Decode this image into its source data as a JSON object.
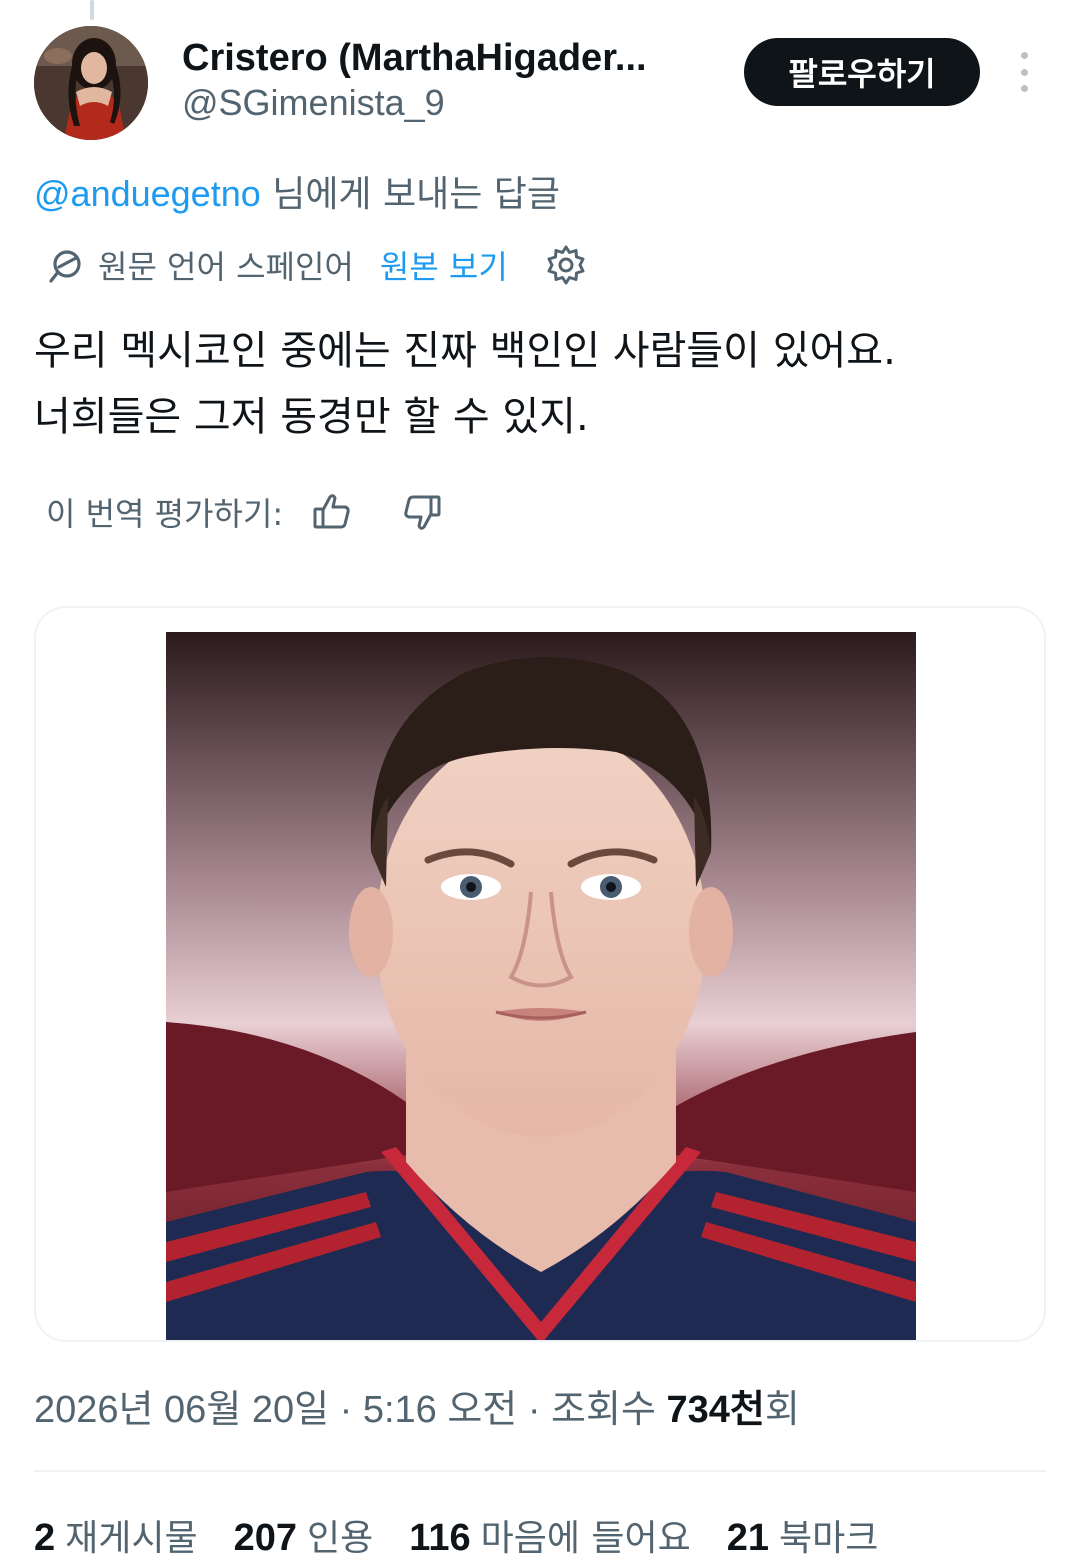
{
  "author": {
    "display_name": "Cristero (MarthaHigader...",
    "handle": "@SGimenista_9",
    "follow_label": "팔로우하기"
  },
  "reply": {
    "mention": "@anduegetno",
    "suffix": " 님에게 보내는 답글"
  },
  "translation": {
    "source_label": "원문 언어 스페인어",
    "show_original": "원본 보기"
  },
  "tweet": {
    "line1": "우리 멕시코인 중에는 진짜 백인인 사람들이 있어요.",
    "line2": "너희들은 그저 동경만 할 수 있지."
  },
  "rate": {
    "label": "이 번역 평가하기:"
  },
  "meta": {
    "prefix": "2026년 06월 20일 · 5:16 오전 · 조회수 ",
    "views": "734천",
    "suffix": "회"
  },
  "stats": [
    {
      "num": "2",
      "label": "재게시물"
    },
    {
      "num": "207",
      "label": "인용"
    },
    {
      "num": "116",
      "label": "마음에 들어요"
    },
    {
      "num": "21",
      "label": "북마크"
    }
  ],
  "colors": {
    "accent": "#1d9bf0",
    "text": "#0f1419",
    "secondary": "#536471",
    "button": "#0f1419"
  },
  "icons": {
    "translate": "translate-icon",
    "settings": "gear-icon",
    "like": "thumbs-up-icon",
    "dislike": "thumbs-down-icon",
    "more": "more-vertical-icon"
  }
}
